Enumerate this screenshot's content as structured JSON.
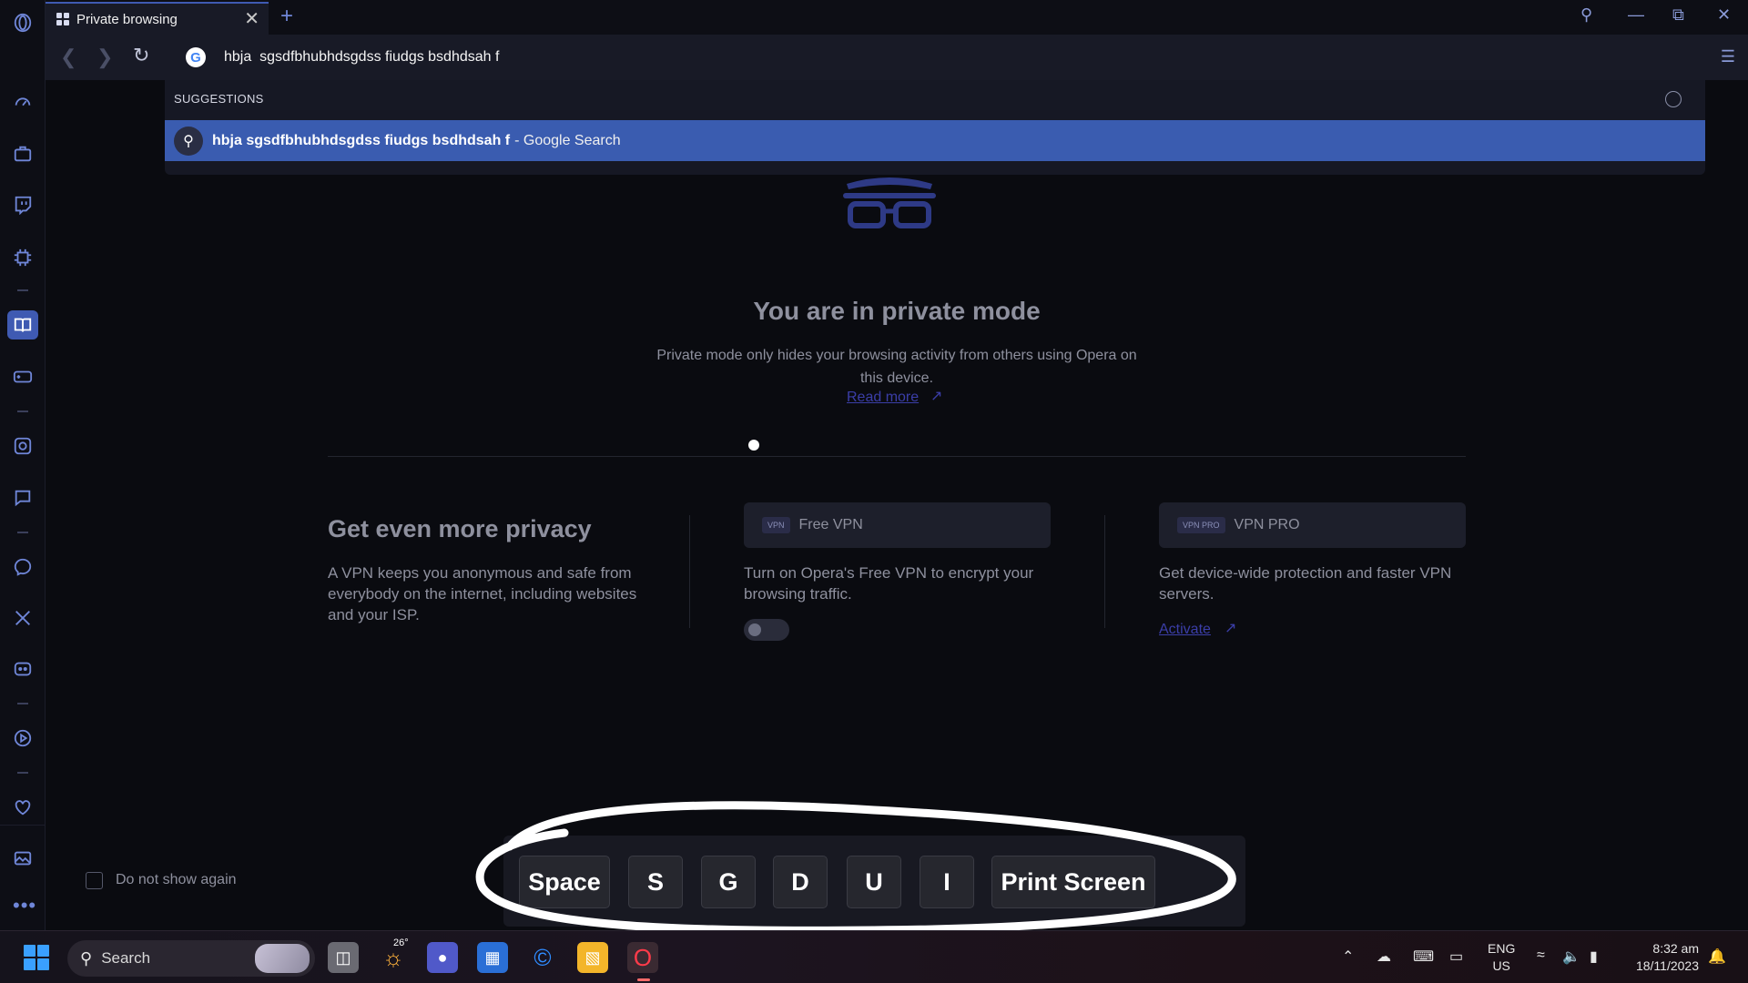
{
  "tab": {
    "title": "Private browsing",
    "close_glyph": "✕",
    "new_tab_glyph": "+"
  },
  "address_bar": {
    "value": "hbja  sgsdfbhubhdsgdss fiudgs bsdhdsah f"
  },
  "suggestions": {
    "heading": "SUGGESTIONS",
    "items": [
      {
        "query": "hbja sgsdfbhubhdsgdss fiudgs bsdhdsah f",
        "suffix": "- Google Search"
      }
    ]
  },
  "private_page": {
    "title": "You are in private mode",
    "description": "Private mode only hides your browsing activity from others using Opera on this device.",
    "read_more": "Read more",
    "privacy_title": "Get even more privacy",
    "privacy_description": "A VPN keeps you anonymous and safe from everybody on the internet, including websites and your ISP.",
    "free_vpn": {
      "badge": "VPN",
      "name": "Free VPN",
      "description": "Turn on Opera's Free VPN to encrypt your browsing traffic.",
      "enabled": false
    },
    "vpn_pro": {
      "badge": "VPN PRO",
      "name": "VPN PRO",
      "description": "Get device-wide protection and faster VPN servers.",
      "activate": "Activate"
    },
    "do_not_show": "Do not show again"
  },
  "keys_overlay": [
    "Space",
    "S",
    "G",
    "D",
    "U",
    "I",
    "Print Screen"
  ],
  "sidebar": {
    "icons": [
      "opera-logo-icon",
      "speed-dial-icon",
      "briefcase-icon",
      "twitch-icon",
      "cpu-icon",
      "reader-icon",
      "games-icon",
      "chatgpt-icon",
      "chatsonic-icon",
      "messenger-icon",
      "x-icon",
      "discord-icon",
      "player-icon",
      "heart-icon",
      "gallery-icon",
      "more-icon"
    ]
  },
  "taskbar": {
    "search_label": "Search",
    "weather_temp": "26°",
    "language": "ENG",
    "region": "US",
    "time": "8:32 am",
    "date": "18/11/2023"
  },
  "colors": {
    "accent": "#3a5cb0",
    "background": "#0a0b10",
    "muted_text": "#8e909e",
    "link": "#3b3ea8"
  }
}
